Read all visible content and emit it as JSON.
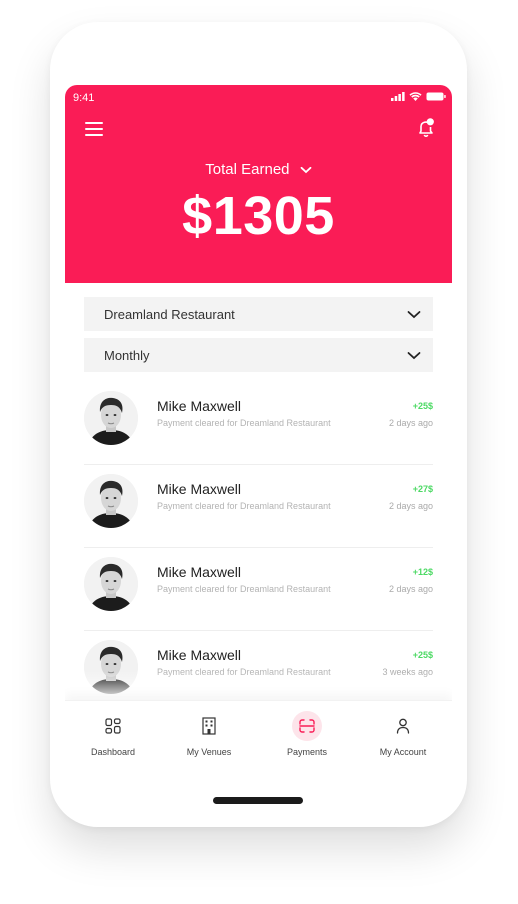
{
  "status_bar": {
    "time": "9:41"
  },
  "header": {
    "total_label": "Total Earned",
    "total_amount": "$1305"
  },
  "filters": {
    "venue": "Dreamland Restaurant",
    "period": "Monthly"
  },
  "payments": [
    {
      "name": "Mike Maxwell",
      "description": "Payment cleared for Dreamland Restaurant",
      "amount": "+25$",
      "time": "2 days ago"
    },
    {
      "name": "Mike Maxwell",
      "description": "Payment cleared for Dreamland Restaurant",
      "amount": "+27$",
      "time": "2 days ago"
    },
    {
      "name": "Mike Maxwell",
      "description": "Payment cleared for Dreamland Restaurant",
      "amount": "+12$",
      "time": "2 days ago"
    },
    {
      "name": "Mike Maxwell",
      "description": "Payment cleared for Dreamland Restaurant",
      "amount": "+25$",
      "time": "3 weeks ago"
    }
  ],
  "tabbar": {
    "dashboard": "Dashboard",
    "venues": "My Venues",
    "payments": "Payments",
    "account": "My Account"
  },
  "colors": {
    "accent": "#fa1c56",
    "positive": "#4cd964"
  }
}
